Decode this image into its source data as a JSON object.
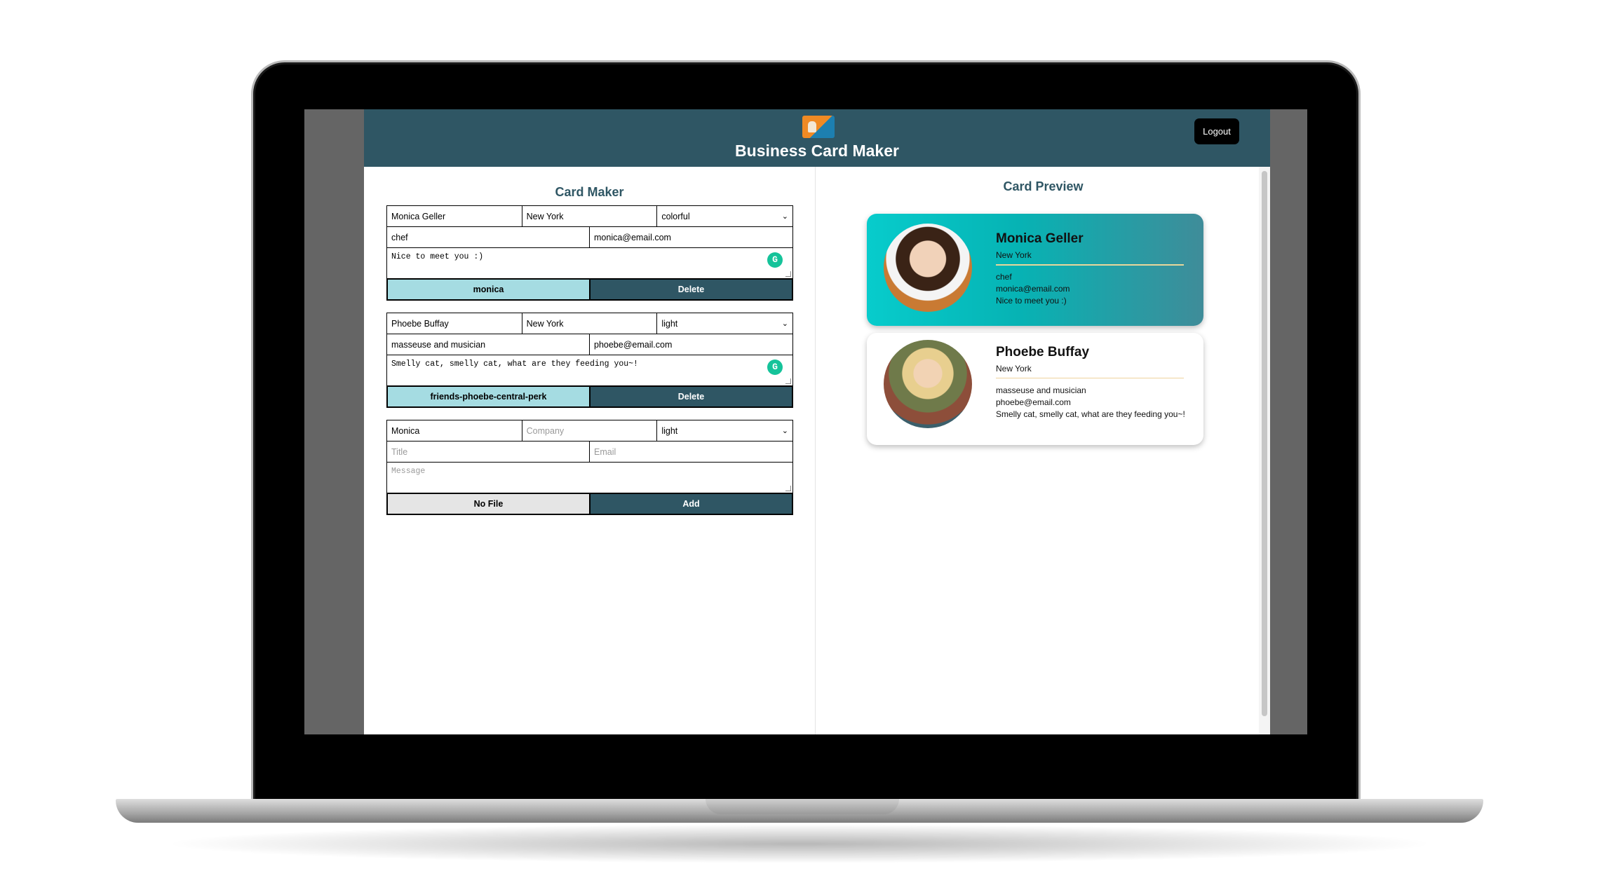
{
  "header": {
    "title": "Business Card Maker",
    "logout_label": "Logout"
  },
  "maker": {
    "title": "Card Maker",
    "cards": [
      {
        "name": "Monica Geller",
        "company": "New York",
        "theme": "colorful",
        "title": "chef",
        "email": "monica@email.com",
        "message": "Nice to meet you :)",
        "file_label": "monica",
        "action_label": "Delete"
      },
      {
        "name": "Phoebe Buffay",
        "company": "New York",
        "theme": "light",
        "title": " masseuse and musician",
        "email": "phoebe@email.com",
        "message": "Smelly cat, smelly cat, what are they feeding you~!",
        "file_label": "friends-phoebe-central-perk",
        "action_label": "Delete"
      }
    ],
    "new_card": {
      "name": "Monica",
      "company_placeholder": "Company",
      "theme": "light",
      "title_placeholder": "Title",
      "email_placeholder": "Email",
      "message_placeholder": "Message",
      "file_label": "No File",
      "action_label": "Add"
    }
  },
  "preview": {
    "title": "Card Preview",
    "cards": [
      {
        "name": "Monica Geller",
        "company": "New York",
        "title": "chef",
        "email": "monica@email.com",
        "message": "Nice to meet you :)",
        "theme": "colorful"
      },
      {
        "name": "Phoebe Buffay",
        "company": "New York",
        "title": "masseuse and musician",
        "email": "phoebe@email.com",
        "message": "Smelly cat, smelly cat, what are they feeding you~!",
        "theme": "light"
      }
    ]
  },
  "colors": {
    "header": "#2f5664",
    "file_button": "#a5dce2",
    "colorful_card_start": "#07cccc",
    "colorful_card_end": "#3f8c99"
  },
  "icons": {
    "grammarly": "grammarly-icon",
    "select": "chevron-down-icon"
  }
}
